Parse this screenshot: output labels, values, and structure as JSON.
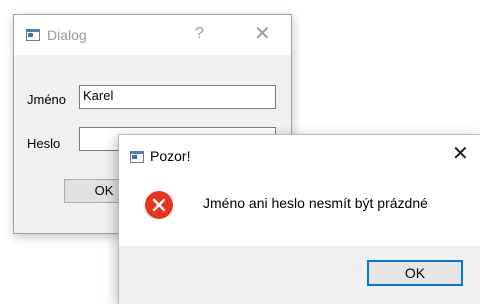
{
  "dialog": {
    "title": "Dialog",
    "help_label": "?",
    "close_label": "✕",
    "name_label": "Jméno",
    "name_value": "Karel",
    "password_label": "Heslo",
    "password_value": "",
    "ok_label": "OK"
  },
  "alert": {
    "title": "Pozor!",
    "close_label": "✕",
    "icon": "error-icon",
    "message": "Jméno ani heslo nesmít být prázdné",
    "ok_label": "OK"
  },
  "colors": {
    "error_icon": "#e8331f",
    "focus_border": "#0078d7"
  }
}
